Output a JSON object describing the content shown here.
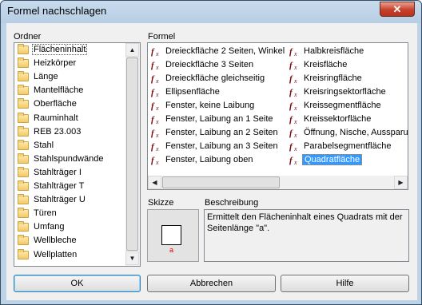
{
  "window": {
    "title": "Formel nachschlagen"
  },
  "labels": {
    "folders": "Ordner",
    "formula": "Formel",
    "sketch": "Skizze",
    "description": "Beschreibung"
  },
  "folders": [
    "Flächeninhalt",
    "Heizkörper",
    "Länge",
    "Mantelfläche",
    "Oberfläche",
    "Rauminhalt",
    "REB 23.003",
    "Stahl",
    "Stahlspundwände",
    "Stahlträger I",
    "Stahlträger T",
    "Stahlträger U",
    "Türen",
    "Umfang",
    "Wellbleche",
    "Wellplatten"
  ],
  "selected_folder": "Flächeninhalt",
  "formulas_col1": [
    "Dreieckfläche 2 Seiten, Winkel",
    "Dreieckfläche 3 Seiten",
    "Dreieckfläche gleichseitig",
    "Ellipsenfläche",
    "Fenster, keine Laibung",
    "Fenster, Laibung an 1 Seite",
    "Fenster, Laibung an 2 Seiten",
    "Fenster, Laibung an 3 Seiten",
    "Fenster, Laibung oben"
  ],
  "formulas_col2": [
    "Halbkreisfläche",
    "Kreisfläche",
    "Kreisringfläche",
    "Kreisringsektorfläche",
    "Kreissegmentfläche",
    "Kreissektorfläche",
    "Öffnung, Nische, Aussparung",
    "Parabelsegmentfläche",
    "Quadratfläche"
  ],
  "selected_formula": "Quadratfläche",
  "sketch": {
    "label": "a"
  },
  "description": "Ermittelt den Flächeninhalt eines Quadrats mit der Seitenlänge \"a\".",
  "buttons": {
    "ok": "OK",
    "cancel": "Abbrechen",
    "help": "Hilfe"
  },
  "icons": {
    "close": "close-icon",
    "folder": "folder-icon",
    "formula": "fx-icon"
  },
  "colors": {
    "selection": "#3399ff",
    "sketch_label": "#e00000"
  }
}
